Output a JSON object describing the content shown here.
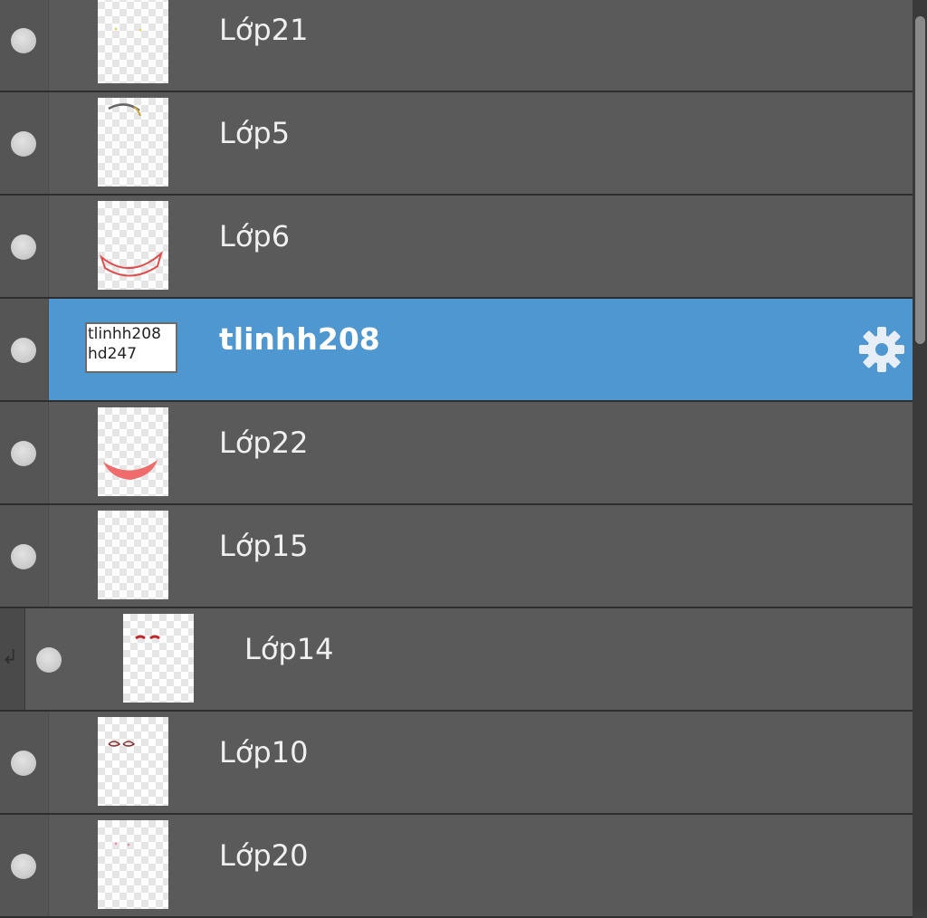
{
  "layers": [
    {
      "name": "Lớp21",
      "thumb": "blank-yellow-dots",
      "selected": false,
      "clipped": false
    },
    {
      "name": "Lớp5",
      "thumb": "arc-stroke",
      "selected": false,
      "clipped": false
    },
    {
      "name": "Lớp6",
      "thumb": "red-mouth-outline",
      "selected": false,
      "clipped": false
    },
    {
      "name": "tlinhh208",
      "thumb": "text-layer",
      "thumb_text": "tlinhh208\nhd247",
      "selected": true,
      "clipped": false
    },
    {
      "name": "Lớp22",
      "thumb": "red-mouth-fill",
      "selected": false,
      "clipped": false
    },
    {
      "name": "Lớp15",
      "thumb": "blank",
      "selected": false,
      "clipped": false
    },
    {
      "name": "Lớp14",
      "thumb": "red-eyes",
      "selected": false,
      "clipped": true
    },
    {
      "name": "Lớp10",
      "thumb": "eye-sketch",
      "selected": false,
      "clipped": false
    },
    {
      "name": "Lớp20",
      "thumb": "pink-dots",
      "selected": false,
      "clipped": false
    }
  ],
  "icons": {
    "visibility": "eye-toggle-icon",
    "settings": "gear-icon",
    "clip": "clipping-arrow-icon"
  },
  "colors": {
    "panel_bg": "#5a5a5a",
    "selected_bg": "#4e97d0",
    "separator": "#2e2e2e",
    "text": "#f0f0f0"
  }
}
